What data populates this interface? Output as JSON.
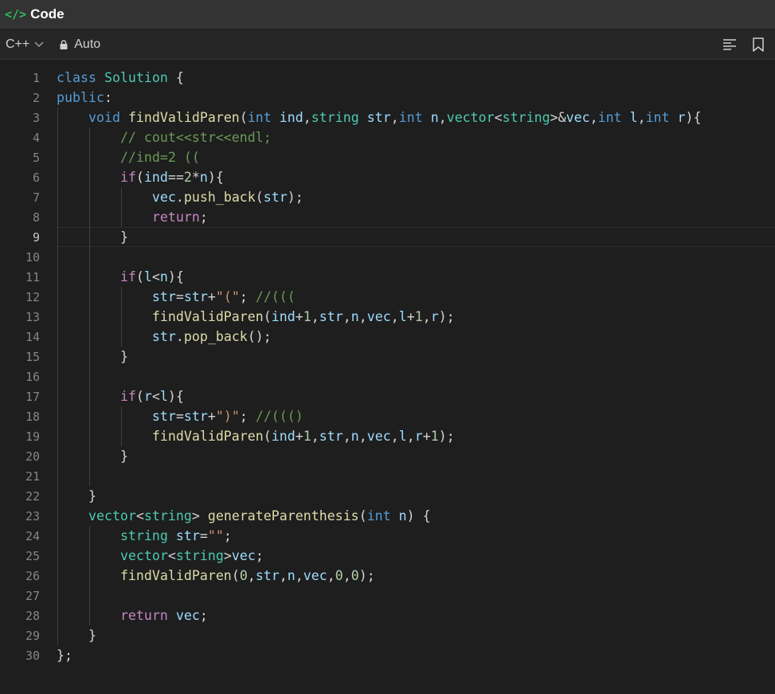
{
  "header": {
    "icon": "code-brackets-icon",
    "title": "Code"
  },
  "toolbar": {
    "language": "C++",
    "mode": "Auto",
    "icons": [
      "format-lines-icon",
      "bookmark-icon"
    ]
  },
  "editor": {
    "active_line": 9,
    "lines": [
      {
        "n": "1",
        "indent": 0,
        "tokens": [
          [
            "kw",
            "class"
          ],
          [
            "pl",
            " "
          ],
          [
            "ty",
            "Solution"
          ],
          [
            "pl",
            " {"
          ]
        ]
      },
      {
        "n": "2",
        "indent": 0,
        "tokens": [
          [
            "kw",
            "public"
          ],
          [
            "pl",
            ":"
          ]
        ]
      },
      {
        "n": "3",
        "indent": 1,
        "tokens": [
          [
            "kw",
            "void"
          ],
          [
            "pl",
            " "
          ],
          [
            "fn",
            "findValidParen"
          ],
          [
            "pl",
            "("
          ],
          [
            "kw",
            "int"
          ],
          [
            "pl",
            " "
          ],
          [
            "vr",
            "ind"
          ],
          [
            "pl",
            ","
          ],
          [
            "ty",
            "string"
          ],
          [
            "pl",
            " "
          ],
          [
            "vr",
            "str"
          ],
          [
            "pl",
            ","
          ],
          [
            "kw",
            "int"
          ],
          [
            "pl",
            " "
          ],
          [
            "vr",
            "n"
          ],
          [
            "pl",
            ","
          ],
          [
            "ty",
            "vector"
          ],
          [
            "pl",
            "<"
          ],
          [
            "ty",
            "string"
          ],
          [
            "pl",
            ">&"
          ],
          [
            "vr",
            "vec"
          ],
          [
            "pl",
            ","
          ],
          [
            "kw",
            "int"
          ],
          [
            "pl",
            " "
          ],
          [
            "vr",
            "l"
          ],
          [
            "pl",
            ","
          ],
          [
            "kw",
            "int"
          ],
          [
            "pl",
            " "
          ],
          [
            "vr",
            "r"
          ],
          [
            "pl",
            "){"
          ]
        ]
      },
      {
        "n": "4",
        "indent": 2,
        "tokens": [
          [
            "cm",
            "// cout<<str<<endl;"
          ]
        ]
      },
      {
        "n": "5",
        "indent": 2,
        "tokens": [
          [
            "cm",
            "//ind=2 (("
          ]
        ]
      },
      {
        "n": "6",
        "indent": 2,
        "tokens": [
          [
            "ct",
            "if"
          ],
          [
            "pl",
            "("
          ],
          [
            "vr",
            "ind"
          ],
          [
            "pl",
            "=="
          ],
          [
            "nm",
            "2"
          ],
          [
            "pl",
            "*"
          ],
          [
            "vr",
            "n"
          ],
          [
            "pl",
            "){"
          ]
        ]
      },
      {
        "n": "7",
        "indent": 3,
        "tokens": [
          [
            "vr",
            "vec"
          ],
          [
            "pl",
            "."
          ],
          [
            "fn",
            "push_back"
          ],
          [
            "pl",
            "("
          ],
          [
            "vr",
            "str"
          ],
          [
            "pl",
            ");"
          ]
        ]
      },
      {
        "n": "8",
        "indent": 3,
        "tokens": [
          [
            "ct",
            "return"
          ],
          [
            "pl",
            ";"
          ]
        ]
      },
      {
        "n": "9",
        "indent": 2,
        "tokens": [
          [
            "pl",
            "}"
          ]
        ]
      },
      {
        "n": "10",
        "indent": 0,
        "tokens": []
      },
      {
        "n": "11",
        "indent": 2,
        "tokens": [
          [
            "ct",
            "if"
          ],
          [
            "pl",
            "("
          ],
          [
            "vr",
            "l"
          ],
          [
            "pl",
            "<"
          ],
          [
            "vr",
            "n"
          ],
          [
            "pl",
            "){"
          ]
        ]
      },
      {
        "n": "12",
        "indent": 3,
        "tokens": [
          [
            "vr",
            "str"
          ],
          [
            "pl",
            "="
          ],
          [
            "vr",
            "str"
          ],
          [
            "pl",
            "+"
          ],
          [
            "st",
            "\"(\""
          ],
          [
            "pl",
            "; "
          ],
          [
            "cm",
            "//((("
          ]
        ]
      },
      {
        "n": "13",
        "indent": 3,
        "tokens": [
          [
            "fn",
            "findValidParen"
          ],
          [
            "pl",
            "("
          ],
          [
            "vr",
            "ind"
          ],
          [
            "pl",
            "+"
          ],
          [
            "nm",
            "1"
          ],
          [
            "pl",
            ","
          ],
          [
            "vr",
            "str"
          ],
          [
            "pl",
            ","
          ],
          [
            "vr",
            "n"
          ],
          [
            "pl",
            ","
          ],
          [
            "vr",
            "vec"
          ],
          [
            "pl",
            ","
          ],
          [
            "vr",
            "l"
          ],
          [
            "pl",
            "+"
          ],
          [
            "nm",
            "1"
          ],
          [
            "pl",
            ","
          ],
          [
            "vr",
            "r"
          ],
          [
            "pl",
            ");"
          ]
        ]
      },
      {
        "n": "14",
        "indent": 3,
        "tokens": [
          [
            "vr",
            "str"
          ],
          [
            "pl",
            "."
          ],
          [
            "fn",
            "pop_back"
          ],
          [
            "pl",
            "();"
          ]
        ]
      },
      {
        "n": "15",
        "indent": 2,
        "tokens": [
          [
            "pl",
            "}"
          ]
        ]
      },
      {
        "n": "16",
        "indent": 0,
        "tokens": []
      },
      {
        "n": "17",
        "indent": 2,
        "tokens": [
          [
            "ct",
            "if"
          ],
          [
            "pl",
            "("
          ],
          [
            "vr",
            "r"
          ],
          [
            "pl",
            "<"
          ],
          [
            "vr",
            "l"
          ],
          [
            "pl",
            "){"
          ]
        ]
      },
      {
        "n": "18",
        "indent": 3,
        "tokens": [
          [
            "vr",
            "str"
          ],
          [
            "pl",
            "="
          ],
          [
            "vr",
            "str"
          ],
          [
            "pl",
            "+"
          ],
          [
            "st",
            "\")\""
          ],
          [
            "pl",
            "; "
          ],
          [
            "cm",
            "//((()"
          ]
        ]
      },
      {
        "n": "19",
        "indent": 3,
        "tokens": [
          [
            "fn",
            "findValidParen"
          ],
          [
            "pl",
            "("
          ],
          [
            "vr",
            "ind"
          ],
          [
            "pl",
            "+"
          ],
          [
            "nm",
            "1"
          ],
          [
            "pl",
            ","
          ],
          [
            "vr",
            "str"
          ],
          [
            "pl",
            ","
          ],
          [
            "vr",
            "n"
          ],
          [
            "pl",
            ","
          ],
          [
            "vr",
            "vec"
          ],
          [
            "pl",
            ","
          ],
          [
            "vr",
            "l"
          ],
          [
            "pl",
            ","
          ],
          [
            "vr",
            "r"
          ],
          [
            "pl",
            "+"
          ],
          [
            "nm",
            "1"
          ],
          [
            "pl",
            ");"
          ]
        ]
      },
      {
        "n": "20",
        "indent": 2,
        "tokens": [
          [
            "pl",
            "}"
          ]
        ]
      },
      {
        "n": "21",
        "indent": 0,
        "tokens": []
      },
      {
        "n": "22",
        "indent": 1,
        "tokens": [
          [
            "pl",
            "}"
          ]
        ]
      },
      {
        "n": "23",
        "indent": 1,
        "tokens": [
          [
            "ty",
            "vector"
          ],
          [
            "pl",
            "<"
          ],
          [
            "ty",
            "string"
          ],
          [
            "pl",
            "> "
          ],
          [
            "fn",
            "generateParenthesis"
          ],
          [
            "pl",
            "("
          ],
          [
            "kw",
            "int"
          ],
          [
            "pl",
            " "
          ],
          [
            "vr",
            "n"
          ],
          [
            "pl",
            ") {"
          ]
        ]
      },
      {
        "n": "24",
        "indent": 2,
        "tokens": [
          [
            "ty",
            "string"
          ],
          [
            "pl",
            " "
          ],
          [
            "vr",
            "str"
          ],
          [
            "pl",
            "="
          ],
          [
            "st",
            "\"\""
          ],
          [
            "pl",
            ";"
          ]
        ]
      },
      {
        "n": "25",
        "indent": 2,
        "tokens": [
          [
            "ty",
            "vector"
          ],
          [
            "pl",
            "<"
          ],
          [
            "ty",
            "string"
          ],
          [
            "pl",
            ">"
          ],
          [
            "vr",
            "vec"
          ],
          [
            "pl",
            ";"
          ]
        ]
      },
      {
        "n": "26",
        "indent": 2,
        "tokens": [
          [
            "fn",
            "findValidParen"
          ],
          [
            "pl",
            "("
          ],
          [
            "nm",
            "0"
          ],
          [
            "pl",
            ","
          ],
          [
            "vr",
            "str"
          ],
          [
            "pl",
            ","
          ],
          [
            "vr",
            "n"
          ],
          [
            "pl",
            ","
          ],
          [
            "vr",
            "vec"
          ],
          [
            "pl",
            ","
          ],
          [
            "nm",
            "0"
          ],
          [
            "pl",
            ","
          ],
          [
            "nm",
            "0"
          ],
          [
            "pl",
            ");"
          ]
        ]
      },
      {
        "n": "27",
        "indent": 0,
        "tokens": []
      },
      {
        "n": "28",
        "indent": 2,
        "tokens": [
          [
            "ct",
            "return"
          ],
          [
            "pl",
            " "
          ],
          [
            "vr",
            "vec"
          ],
          [
            "pl",
            ";"
          ]
        ]
      },
      {
        "n": "29",
        "indent": 1,
        "tokens": [
          [
            "pl",
            "}"
          ]
        ]
      },
      {
        "n": "30",
        "indent": 0,
        "tokens": [
          [
            "pl",
            "};"
          ]
        ]
      }
    ],
    "colors": {
      "keyword": "#569cd6",
      "type": "#4ec9b0",
      "function": "#dcdcaa",
      "variable": "#9cdcfe",
      "comment": "#6a9955",
      "string": "#ce9178",
      "number": "#b5cea8",
      "control": "#c586c0"
    }
  }
}
